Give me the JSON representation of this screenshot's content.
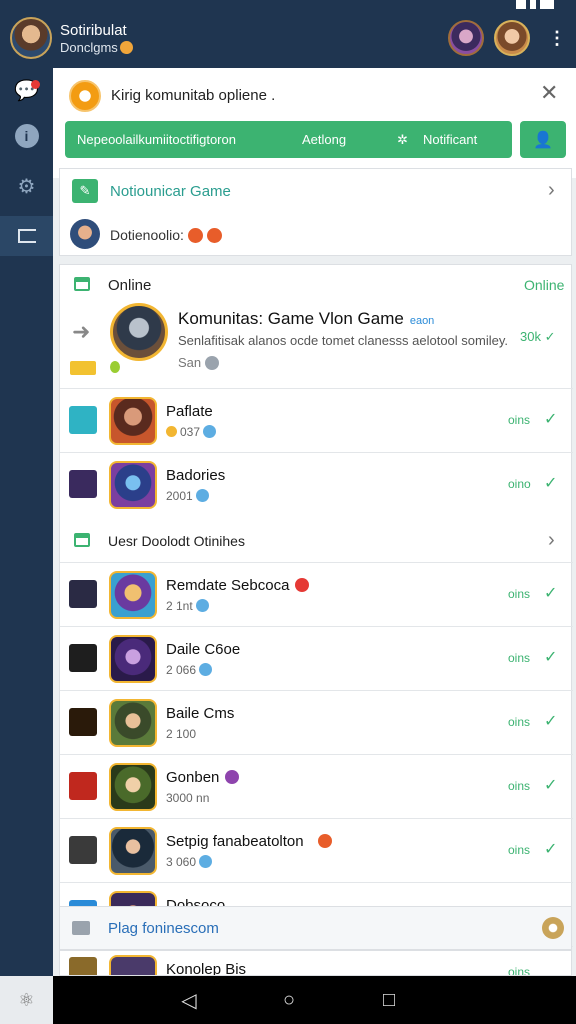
{
  "header": {
    "title": "Sotiribulat",
    "subtitle": "Donclgms"
  },
  "alert": {
    "text": "Kirig komunitab opliene .",
    "close": "✕"
  },
  "greenbar": {
    "text1": "Nepeoolailkumiitoctifigtoron",
    "text2": "Aetlong",
    "text3": "✲",
    "text4": "Notificant"
  },
  "notif": {
    "title": "Notiounicar Game",
    "text": "Dotienoolio:"
  },
  "list": {
    "header": "Online",
    "header_right": "Online",
    "featured": {
      "name": "Komunitas: Game Vlon Game",
      "tag": "eaon",
      "desc": "Senlafitisak alanos ocde tomet clanesss aelotool somiley.",
      "meta": "San",
      "count": "30k"
    },
    "rows": [
      {
        "name": "Paflate",
        "sub": "037",
        "status": "oins"
      },
      {
        "name": "Badories",
        "sub": "2001",
        "status": "oino"
      },
      {
        "name": "Remdate Sebcoca",
        "sub": "2 1nt",
        "status": "oins"
      },
      {
        "name": "Daile C6oe",
        "sub": "2 066",
        "status": "oins"
      },
      {
        "name": "Baile Cms",
        "sub": "2 100",
        "status": "oins"
      },
      {
        "name": "Gonben",
        "sub": "3000 nn",
        "status": "oins"
      },
      {
        "name": "Setpig fanabeatolton",
        "sub": "3 060",
        "status": "oins"
      },
      {
        "name": "Dobsoco",
        "sub": "",
        "status": ""
      }
    ],
    "section": "Uesr Doolodt Otinihes",
    "last_row": {
      "name": "Konolep Bis",
      "status": "oins"
    }
  },
  "pager": {
    "text": "Plag foninescom"
  },
  "colors": {
    "accent": "#3cb371",
    "sidebar": "#1f3550",
    "alert": "#f39c12"
  }
}
